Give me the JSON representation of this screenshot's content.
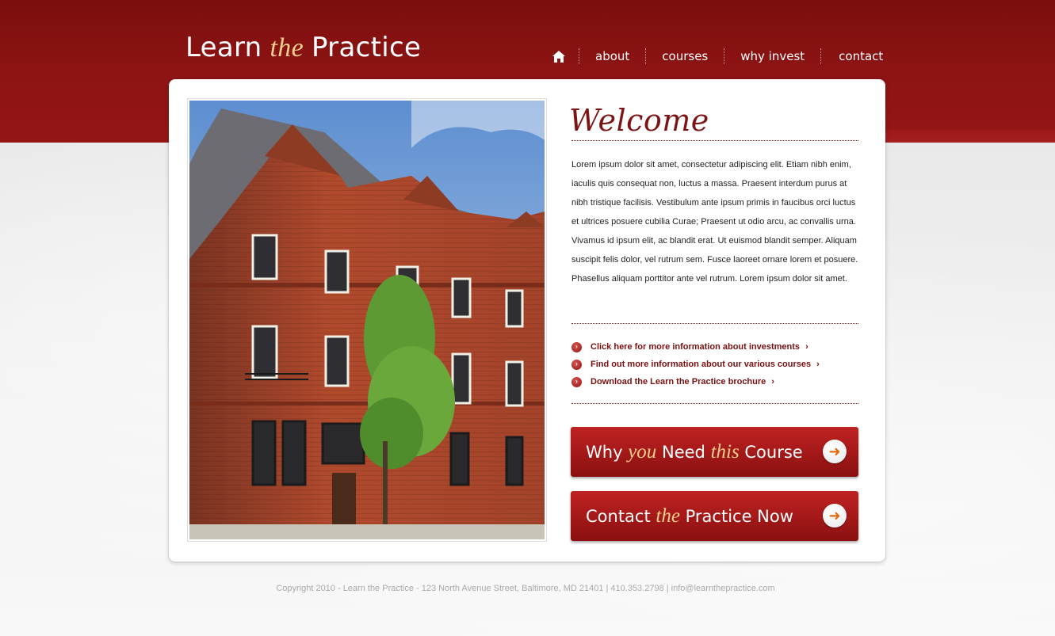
{
  "header": {
    "logo": {
      "word1": "Learn",
      "word2": "the",
      "word3": "Practice"
    },
    "nav": {
      "home_icon": "home-icon",
      "items": [
        "about",
        "courses",
        "why invest",
        "contact"
      ]
    }
  },
  "main": {
    "photo_alt": "building-photo",
    "welcome_title": "Welcome",
    "intro_text": "Lorem ipsum dolor sit amet, consectetur adipiscing elit. Etiam nibh enim, iaculis quis consequat non, luctus a massa. Praesent interdum purus at nibh tristique facilisis. Vestibulum ante ipsum primis in faucibus orci luctus et ultrices posuere cubilia Curae; Praesent ut odio arcu, ac convallis urna. Vivamus id ipsum elit, ac blandit erat. Ut euismod blandit semper. Aliquam suscipit felis dolor, vel rutrum sem. Fusce laoreet ornare lorem et posuere. Phasellus aliquam porttitor ante vel rutrum. Lorem ipsum dolor sit amet.",
    "links": [
      "Click here for more information about investments",
      "Find out more information about our various courses",
      "Download the Learn the Practice brochure"
    ],
    "cta1": {
      "pre": "Why",
      "accent1": "you",
      "mid": "Need",
      "accent2": "this",
      "post": "Course"
    },
    "cta2": {
      "pre": "Contact",
      "accent": "the",
      "post": "Practice Now"
    }
  },
  "footer": {
    "text": "Copyright 2010  -  Learn the Practice  -  123 North Avenue Street, Baltimore, MD 21401  |  410.353.2798  |  info@learnthepractice.com"
  },
  "colors": {
    "brand_red": "#8e1414",
    "accent_gold": "#f4cf8e",
    "link_red": "#7a1010"
  }
}
